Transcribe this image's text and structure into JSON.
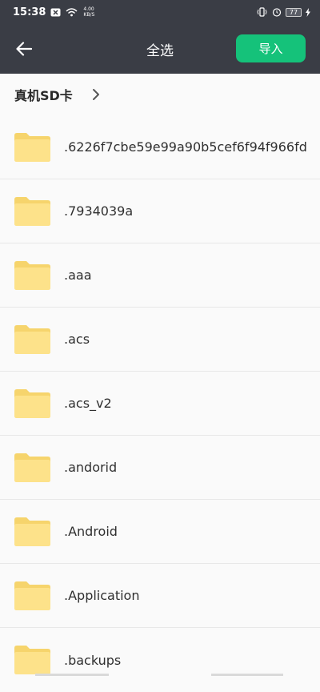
{
  "status_bar": {
    "time": "15:38",
    "net_speed_value": "4.00",
    "net_speed_unit": "KB/S",
    "battery": "77",
    "icons": [
      "notification-x-icon",
      "wifi-icon",
      "vibrate-icon",
      "alarm-icon",
      "battery-icon",
      "charging-icon"
    ]
  },
  "app_bar": {
    "back_icon": "arrow-left-icon",
    "title": "全选",
    "import_label": "导入",
    "accent_color": "#15c27a",
    "background_color": "#3a3d45"
  },
  "breadcrumb": {
    "label": "真机SD卡",
    "icon": "chevron-right-icon"
  },
  "files": [
    {
      "name": ".6226f7cbe59e99a90b5cef6f94f966fd",
      "icon": "folder-icon"
    },
    {
      "name": ".7934039a",
      "icon": "folder-icon"
    },
    {
      "name": ".aaa",
      "icon": "folder-icon"
    },
    {
      "name": ".acs",
      "icon": "folder-icon"
    },
    {
      "name": ".acs_v2",
      "icon": "folder-icon"
    },
    {
      "name": ".andorid",
      "icon": "folder-icon"
    },
    {
      "name": ".Android",
      "icon": "folder-icon"
    },
    {
      "name": ".Application",
      "icon": "folder-icon"
    },
    {
      "name": ".backups",
      "icon": "folder-icon"
    }
  ],
  "colors": {
    "folder": "#fde28a",
    "folder_tab": "#f6d46c"
  }
}
